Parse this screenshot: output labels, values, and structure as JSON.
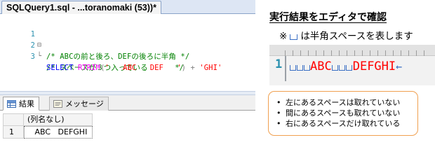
{
  "window": {
    "tab_title": "SQLQuery1.sql - ...toranomaki (53))*"
  },
  "editor": {
    "lines": [
      {
        "num": "1",
        "fold": "⊟",
        "text": "/* ABCの前と後ろ、DEFの後ろに半角 */"
      },
      {
        "num": "2",
        "fold": "└",
        "text": "/* スペースが３つ入っている      */"
      },
      {
        "num": "3",
        "fold": "",
        "select_kw": "SELECT",
        "func": "RTRIM",
        "paren_open": "(",
        "string1": "'   ABC   DEF   '",
        "paren_close": ")",
        "plus": "+",
        "string2": "'GHI'"
      }
    ]
  },
  "results": {
    "tabs": [
      {
        "label": "結果",
        "icon": "grid-icon"
      },
      {
        "label": "メッセージ",
        "icon": "message-icon"
      }
    ],
    "grid": {
      "column_header": "(列名なし)",
      "rows": [
        {
          "num": "1",
          "value": "   ABC   DEFGHI"
        }
      ]
    }
  },
  "panel": {
    "title": "実行結果をエディタで確認",
    "note_prefix": "※",
    "note_suffix": "は半角スペースを表します",
    "zoom": {
      "line_number": "1",
      "seg1": "ABC",
      "seg2": "DEFGHI",
      "end_arrow": "←"
    },
    "summary": [
      "左にあるスペースは取れていない",
      "間にあるスペースも取れていない",
      "右にあるスペースだけ取れている"
    ]
  },
  "colors": {
    "comment": "#008000",
    "keyword": "#0000ff",
    "function": "#ff00ff",
    "string": "#ff0000",
    "line_number": "#2b91af",
    "space_marker": "#3a6fc4",
    "summary_border": "#f0a050"
  }
}
